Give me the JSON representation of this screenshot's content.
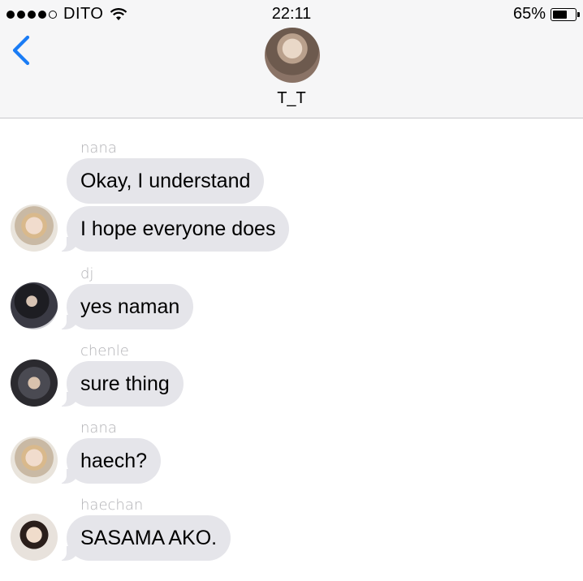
{
  "status_bar": {
    "carrier": "DITO",
    "signal_bars": 4,
    "signal_total": 5,
    "time": "22:11",
    "battery_percent": "65%",
    "battery_level": 0.65
  },
  "header": {
    "contact_name": "T_T",
    "back_icon": "chevron-left-icon",
    "accent_color": "#1a7cf5"
  },
  "messages": [
    {
      "sender": "nana",
      "text": "Okay, I understand"
    },
    {
      "sender": "",
      "text": "I hope everyone does"
    },
    {
      "sender": "dj",
      "text": "yes naman"
    },
    {
      "sender": "chenle",
      "text": "sure thing"
    },
    {
      "sender": "nana",
      "text": "haech?"
    },
    {
      "sender": "haechan",
      "text": "SASAMA AKO."
    }
  ],
  "colors": {
    "bubble": "#e5e5ea",
    "sender_label": "#b2b2b6",
    "header_bg": "#f6f6f7"
  }
}
